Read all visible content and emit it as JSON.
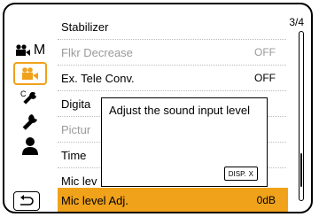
{
  "page_indicator": "3/4",
  "tabs": [
    {
      "name": "movie-mode-tab",
      "label": "M"
    },
    {
      "name": "movie-settings-tab"
    },
    {
      "name": "custom-tab"
    },
    {
      "name": "setup-tab"
    },
    {
      "name": "personal-tab"
    }
  ],
  "menu": {
    "items": [
      {
        "label": "Stabilizer",
        "value": ""
      },
      {
        "label": "Flkr Decrease",
        "value": "OFF"
      },
      {
        "label": "Ex. Tele Conv.",
        "value": "OFF"
      },
      {
        "label": "Digita",
        "value": ""
      },
      {
        "label": "Pictur",
        "value": ""
      },
      {
        "label": "Time",
        "value": ""
      },
      {
        "label": "Mic lev",
        "value": ""
      },
      {
        "label": "Mic level Adj.",
        "value": "0dB"
      }
    ]
  },
  "popup": {
    "message": "Adjust the sound input level",
    "button_label": "DISP.",
    "close_symbol": "X"
  },
  "colors": {
    "accent": "#f0a21b",
    "dim_text": "#9a9a9a"
  }
}
